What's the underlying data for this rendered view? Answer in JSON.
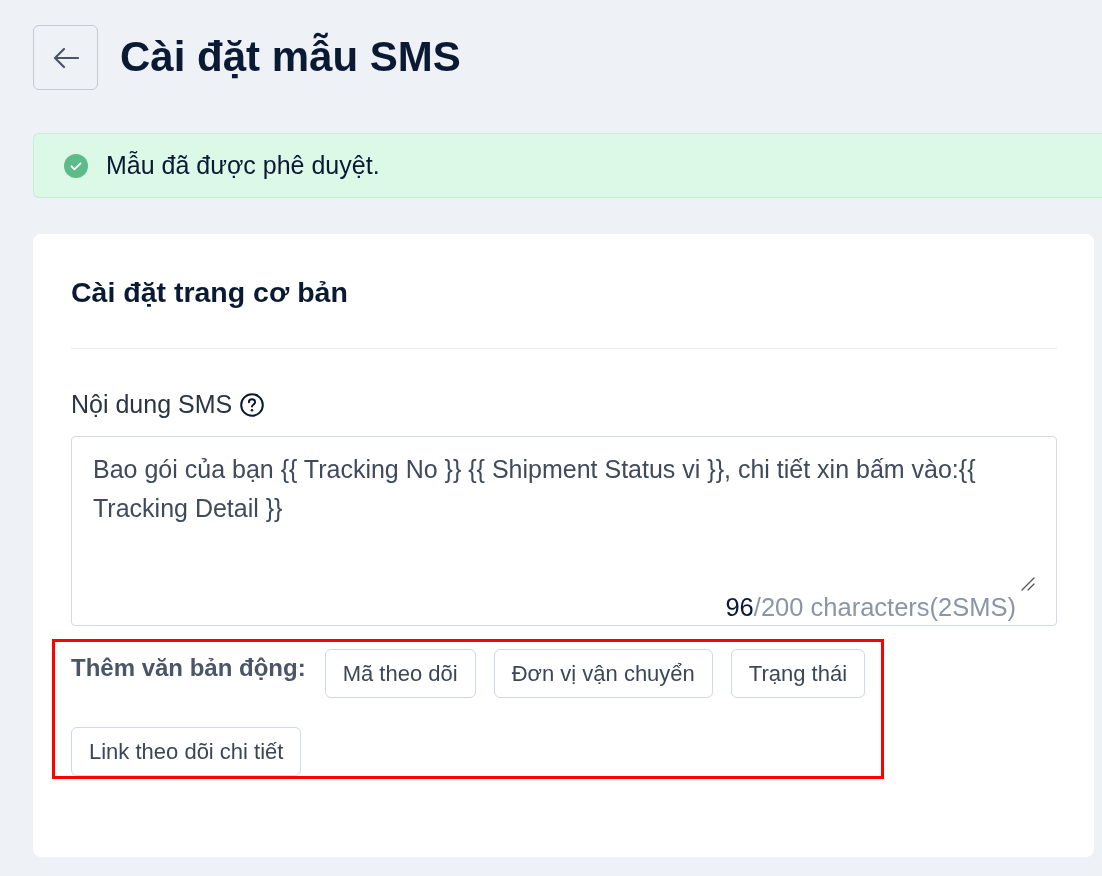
{
  "page": {
    "title": "Cài đặt mẫu SMS"
  },
  "alert": {
    "kind": "success",
    "message": "Mẫu đã được phê duyệt."
  },
  "card": {
    "title": "Cài đặt trang cơ bản",
    "sms_content": {
      "label": "Nội dung SMS",
      "value": "Bao gói của bạn {{ Tracking No }} {{ Shipment Status vi }}, chi tiết xin bấm vào:{{ Tracking Detail }}",
      "counter": {
        "used": "96",
        "limit": "/200 characters(2SMS)"
      }
    },
    "dynamic_text": {
      "label": "Thêm văn bản động:",
      "highlighted": true,
      "buttons": [
        "Mã theo dõi",
        "Đơn vị vận chuyển",
        "Trạng thái",
        "Link theo dõi chi tiết"
      ]
    }
  }
}
